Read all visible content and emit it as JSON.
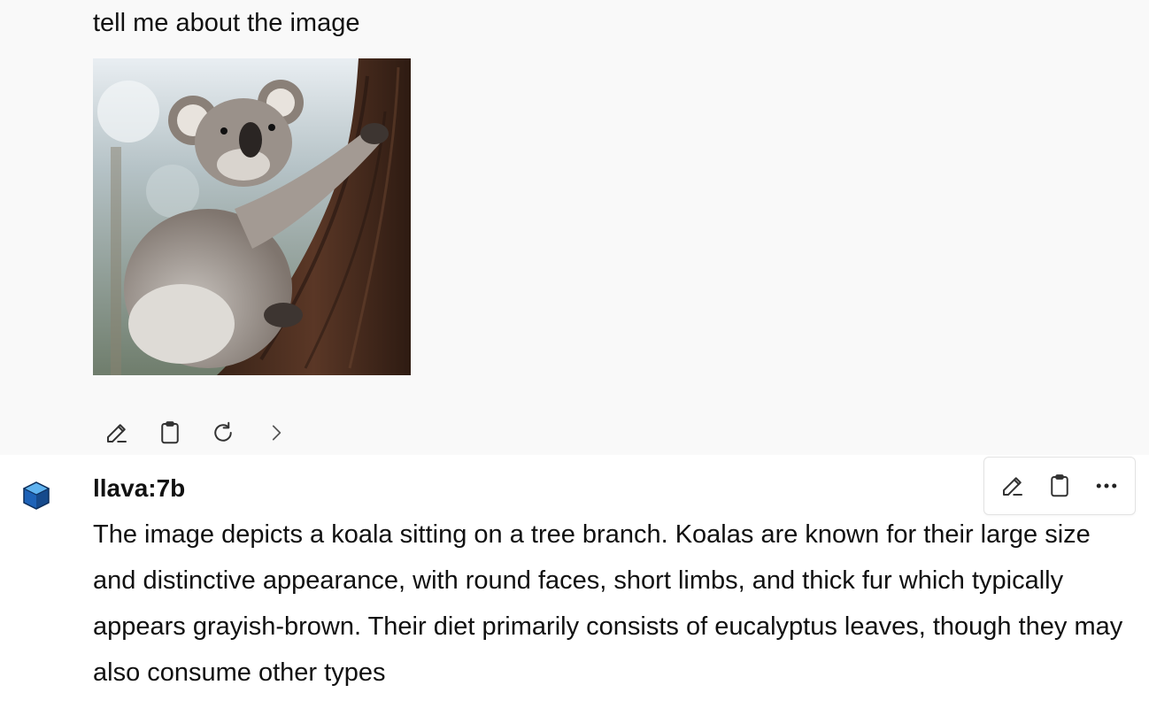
{
  "user_message": {
    "text": "tell me about the image",
    "actions": [
      {
        "icon": "edit-icon"
      },
      {
        "icon": "clipboard-icon"
      },
      {
        "icon": "regenerate-icon"
      },
      {
        "icon": "chevron-right-icon"
      }
    ]
  },
  "assistant_message": {
    "model_name": "llava:7b",
    "response": "The image depicts a koala sitting on a tree branch. Koalas are known for their large size and distinctive appearance, with round faces, short limbs, and thick fur which typically appears grayish-brown. Their diet primarily consists of eucalyptus leaves, though they may also consume other types",
    "toolbar": [
      {
        "icon": "edit-icon"
      },
      {
        "icon": "clipboard-icon"
      },
      {
        "icon": "more-options-icon"
      }
    ]
  },
  "colors": {
    "user_background": "#f9f9f9",
    "assistant_background": "#ffffff",
    "text": "#111111"
  }
}
